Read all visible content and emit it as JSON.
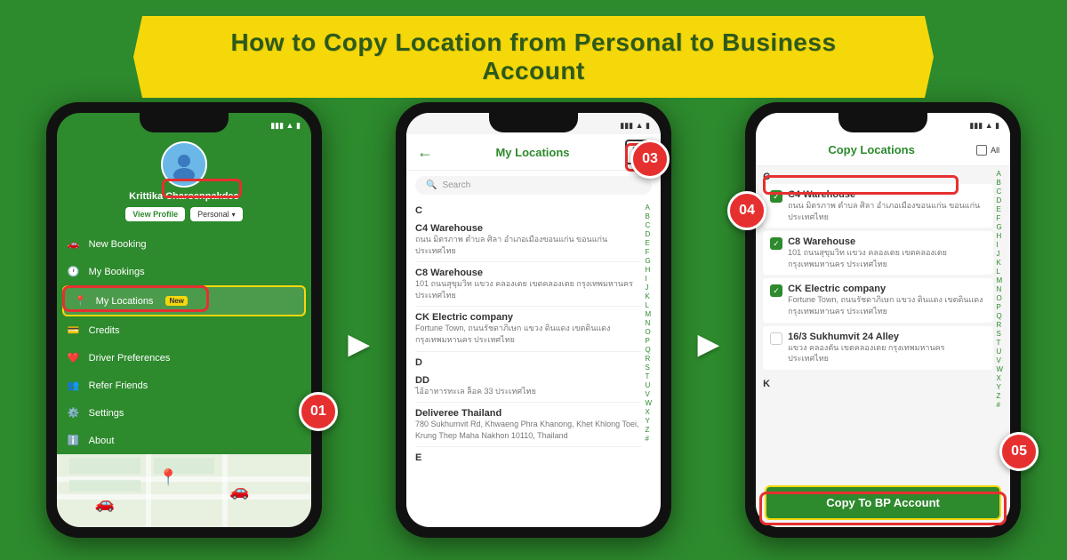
{
  "banner": {
    "title": "How to Copy Location from Personal to Business Account"
  },
  "phone1": {
    "status": "● ▲ ▮▮",
    "user_name": "Krittika Charoenpakdee",
    "view_profile": "View Profile",
    "account_type": "Personal",
    "menu": [
      {
        "icon": "car",
        "label": "New Booking"
      },
      {
        "icon": "clock",
        "label": "My Bookings"
      },
      {
        "icon": "pin",
        "label": "My Locations",
        "badge": "New"
      },
      {
        "icon": "card",
        "label": "Credits"
      },
      {
        "icon": "heart",
        "label": "Driver Preferences"
      },
      {
        "icon": "people",
        "label": "Refer Friends"
      },
      {
        "icon": "gear",
        "label": "Settings"
      },
      {
        "icon": "info",
        "label": "About"
      }
    ],
    "step": "01"
  },
  "phone2": {
    "back_label": "←",
    "title": "My Locations",
    "search_placeholder": "Search",
    "copy_icon": "⎘",
    "step": "03",
    "locations": [
      {
        "letter": "C",
        "items": [
          {
            "name": "C4 Warehouse",
            "addr": "ถนน มิตรภาพ ตำบล ศิลา อำเภอเมืองขอนแก่น ขอนแก่น ประเทศไทย"
          },
          {
            "name": "C8 Warehouse",
            "addr": "101 ถนนสุขุมวิท แขวง คลองเตย เขตคลองเตย กรุงเทพมหานคร ประเทศไทย"
          },
          {
            "name": "CK Electric company",
            "addr": "Fortune Town, ถนนรัชดาภิเษก แขวง ดินแดง เขตดินแดง กรุงเทพมหานคร ประเทศไทย"
          }
        ]
      },
      {
        "letter": "D",
        "items": [
          {
            "name": "DD",
            "addr": "ไอ้อาหารทะเล ล็อค 33 ประเทศไทย"
          },
          {
            "name": "Deliveree Thailand",
            "addr": "780 Sukhumvit Rd, Khwaeng Phra Khanong, Khet Khlong Toei, Krung Thep Maha Nakhon 10110, Thailand"
          }
        ]
      }
    ],
    "alphabet": [
      "A",
      "B",
      "C",
      "D",
      "E",
      "F",
      "G",
      "H",
      "I",
      "J",
      "K",
      "L",
      "M",
      "N",
      "O",
      "P",
      "Q",
      "R",
      "S",
      "T",
      "U",
      "V",
      "W",
      "X",
      "Y",
      "Z",
      "#"
    ]
  },
  "phone3": {
    "title": "Copy Locations",
    "all_label": "All",
    "step_04": "04",
    "step_05": "05",
    "locations": [
      {
        "letter": "C",
        "items": [
          {
            "name": "C4 Warehouse",
            "addr": "ถนน มิตรภาพ ตำบล ศิลา อำเภอเมืองขอนแก่น ขอนแก่น ประเทศไทย",
            "checked": true
          },
          {
            "name": "C8 Warehouse",
            "addr": "101 ถนนสุขุมวิท แขวง คลองเตย เขตคลองเตย กรุงเทพมหานคร ประเทศไทย",
            "checked": true
          },
          {
            "name": "CK Electric company",
            "addr": "Fortune Town, ถนนรัชดาภิเษก แขวง ดินแดง เขตดินแดง กรุงเทพมหานคร ประเทศไทย",
            "checked": true
          },
          {
            "name": "16/3 Sukhumvit 24 Alley",
            "addr": "แขวง คลองตัน เขตคลองเตย กรุงเทพมหานคร ประเทศไทย",
            "checked": false
          }
        ]
      },
      {
        "letter": "K",
        "items": []
      }
    ],
    "alphabet": [
      "A",
      "B",
      "C",
      "D",
      "E",
      "F",
      "G",
      "H",
      "I",
      "J",
      "K",
      "L",
      "M",
      "N",
      "O",
      "P",
      "Q",
      "R",
      "S",
      "T",
      "U",
      "V",
      "W",
      "X",
      "Y",
      "Z",
      "#"
    ],
    "copy_btn_label": "Copy To BP Account"
  }
}
